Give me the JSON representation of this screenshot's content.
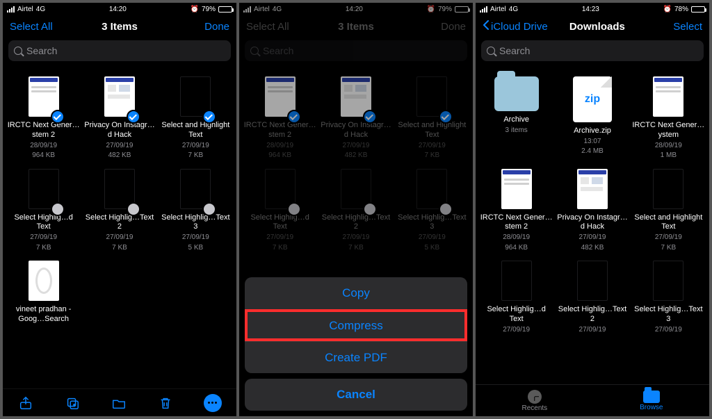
{
  "phone1": {
    "status": {
      "carrier": "Airtel",
      "network": "4G",
      "time": "14:20",
      "battery": "79%"
    },
    "nav": {
      "left": "Select All",
      "title": "3 Items",
      "right": "Done"
    },
    "search_placeholder": "Search",
    "files": [
      {
        "title": "IRCTC Next Gener…stem 2",
        "date": "28/09/19",
        "size": "964 KB",
        "selected": true,
        "thumb": "doc"
      },
      {
        "title": "Privacy On Instagr…d Hack",
        "date": "27/09/19",
        "size": "482 KB",
        "selected": true,
        "thumb": "mock"
      },
      {
        "title": "Select and Highlight Text",
        "date": "27/09/19",
        "size": "7 KB",
        "selected": true,
        "thumb": "blank"
      },
      {
        "title": "Select Highlig…d Text",
        "date": "27/09/19",
        "size": "7 KB",
        "selected": false,
        "thumb": "blank"
      },
      {
        "title": "Select Highlig…Text 2",
        "date": "27/09/19",
        "size": "7 KB",
        "selected": false,
        "thumb": "blank"
      },
      {
        "title": "Select Highlig…Text 3",
        "date": "27/09/19",
        "size": "5 KB",
        "selected": false,
        "thumb": "blank"
      },
      {
        "title": "vineet pradhan - Goog…Search",
        "date": "",
        "size": "",
        "selected": null,
        "thumb": "circle"
      }
    ]
  },
  "phone2": {
    "status": {
      "carrier": "Airtel",
      "network": "4G",
      "time": "14:20",
      "battery": "79%"
    },
    "nav": {
      "left": "Select All",
      "title": "3 Items",
      "right": "Done"
    },
    "search_placeholder": "Search",
    "files": [
      {
        "title": "IRCTC Next Gener…stem 2",
        "date": "28/09/19",
        "size": "964 KB",
        "selected": true,
        "thumb": "doc"
      },
      {
        "title": "Privacy On Instagr…d Hack",
        "date": "27/09/19",
        "size": "482 KB",
        "selected": true,
        "thumb": "mock"
      },
      {
        "title": "Select and Highlight Text",
        "date": "27/09/19",
        "size": "7 KB",
        "selected": true,
        "thumb": "blank"
      },
      {
        "title": "Select Highlig…d Text",
        "date": "27/09/19",
        "size": "7 KB",
        "selected": false,
        "thumb": "blank"
      },
      {
        "title": "Select Highlig…Text 2",
        "date": "27/09/19",
        "size": "7 KB",
        "selected": false,
        "thumb": "blank"
      },
      {
        "title": "Select Highlig…Text 3",
        "date": "27/09/19",
        "size": "5 KB",
        "selected": false,
        "thumb": "blank"
      }
    ],
    "sheet": {
      "options": [
        "Copy",
        "Compress",
        "Create PDF"
      ],
      "highlight_index": 1,
      "cancel": "Cancel"
    }
  },
  "phone3": {
    "status": {
      "carrier": "Airtel",
      "network": "4G",
      "time": "14:23",
      "battery": "78%"
    },
    "nav": {
      "back": "iCloud Drive",
      "title": "Downloads",
      "right": "Select"
    },
    "search_placeholder": "Search",
    "files": [
      {
        "title": "Archive",
        "meta1": "3 items",
        "meta2": "",
        "kind": "folder"
      },
      {
        "title": "Archive.zip",
        "meta1": "13:07",
        "meta2": "2.4 MB",
        "kind": "zip"
      },
      {
        "title": "IRCTC Next Gener…ystem",
        "meta1": "28/09/19",
        "meta2": "1 MB",
        "kind": "doc"
      },
      {
        "title": "IRCTC Next Gener…stem 2",
        "meta1": "28/09/19",
        "meta2": "964 KB",
        "kind": "doc"
      },
      {
        "title": "Privacy On Instagr…d Hack",
        "meta1": "27/09/19",
        "meta2": "482 KB",
        "kind": "mock"
      },
      {
        "title": "Select and Highlight Text",
        "meta1": "27/09/19",
        "meta2": "7 KB",
        "kind": "blank"
      },
      {
        "title": "Select Highlig…d Text",
        "meta1": "27/09/19",
        "meta2": "",
        "kind": "blank"
      },
      {
        "title": "Select Highlig…Text 2",
        "meta1": "27/09/19",
        "meta2": "",
        "kind": "blank"
      },
      {
        "title": "Select Highlig…Text 3",
        "meta1": "27/09/19",
        "meta2": "",
        "kind": "blank"
      }
    ],
    "tabs": {
      "recents": "Recents",
      "browse": "Browse"
    }
  }
}
